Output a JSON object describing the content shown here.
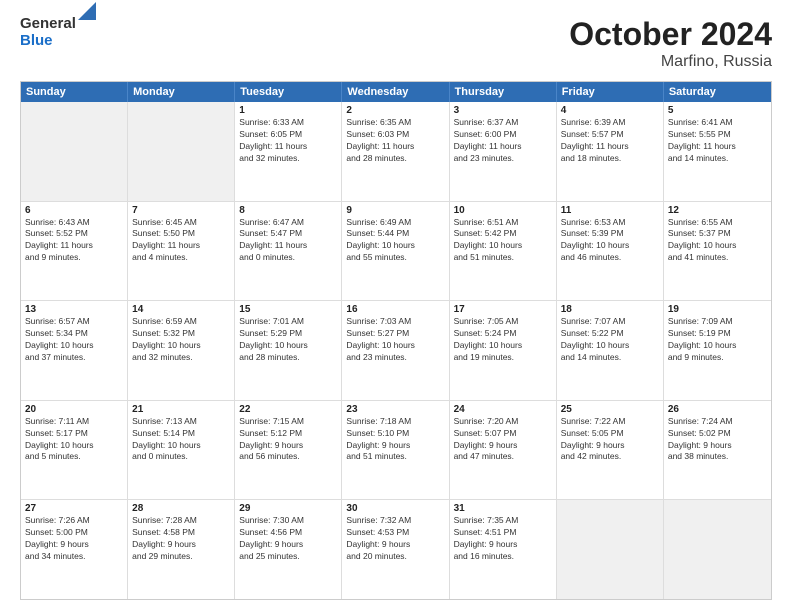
{
  "logo": {
    "general": "General",
    "blue": "Blue"
  },
  "title": "October 2024",
  "subtitle": "Marfino, Russia",
  "header_days": [
    "Sunday",
    "Monday",
    "Tuesday",
    "Wednesday",
    "Thursday",
    "Friday",
    "Saturday"
  ],
  "weeks": [
    [
      {
        "day": "",
        "info": ""
      },
      {
        "day": "",
        "info": ""
      },
      {
        "day": "1",
        "info": "Sunrise: 6:33 AM\nSunset: 6:05 PM\nDaylight: 11 hours\nand 32 minutes."
      },
      {
        "day": "2",
        "info": "Sunrise: 6:35 AM\nSunset: 6:03 PM\nDaylight: 11 hours\nand 28 minutes."
      },
      {
        "day": "3",
        "info": "Sunrise: 6:37 AM\nSunset: 6:00 PM\nDaylight: 11 hours\nand 23 minutes."
      },
      {
        "day": "4",
        "info": "Sunrise: 6:39 AM\nSunset: 5:57 PM\nDaylight: 11 hours\nand 18 minutes."
      },
      {
        "day": "5",
        "info": "Sunrise: 6:41 AM\nSunset: 5:55 PM\nDaylight: 11 hours\nand 14 minutes."
      }
    ],
    [
      {
        "day": "6",
        "info": "Sunrise: 6:43 AM\nSunset: 5:52 PM\nDaylight: 11 hours\nand 9 minutes."
      },
      {
        "day": "7",
        "info": "Sunrise: 6:45 AM\nSunset: 5:50 PM\nDaylight: 11 hours\nand 4 minutes."
      },
      {
        "day": "8",
        "info": "Sunrise: 6:47 AM\nSunset: 5:47 PM\nDaylight: 11 hours\nand 0 minutes."
      },
      {
        "day": "9",
        "info": "Sunrise: 6:49 AM\nSunset: 5:44 PM\nDaylight: 10 hours\nand 55 minutes."
      },
      {
        "day": "10",
        "info": "Sunrise: 6:51 AM\nSunset: 5:42 PM\nDaylight: 10 hours\nand 51 minutes."
      },
      {
        "day": "11",
        "info": "Sunrise: 6:53 AM\nSunset: 5:39 PM\nDaylight: 10 hours\nand 46 minutes."
      },
      {
        "day": "12",
        "info": "Sunrise: 6:55 AM\nSunset: 5:37 PM\nDaylight: 10 hours\nand 41 minutes."
      }
    ],
    [
      {
        "day": "13",
        "info": "Sunrise: 6:57 AM\nSunset: 5:34 PM\nDaylight: 10 hours\nand 37 minutes."
      },
      {
        "day": "14",
        "info": "Sunrise: 6:59 AM\nSunset: 5:32 PM\nDaylight: 10 hours\nand 32 minutes."
      },
      {
        "day": "15",
        "info": "Sunrise: 7:01 AM\nSunset: 5:29 PM\nDaylight: 10 hours\nand 28 minutes."
      },
      {
        "day": "16",
        "info": "Sunrise: 7:03 AM\nSunset: 5:27 PM\nDaylight: 10 hours\nand 23 minutes."
      },
      {
        "day": "17",
        "info": "Sunrise: 7:05 AM\nSunset: 5:24 PM\nDaylight: 10 hours\nand 19 minutes."
      },
      {
        "day": "18",
        "info": "Sunrise: 7:07 AM\nSunset: 5:22 PM\nDaylight: 10 hours\nand 14 minutes."
      },
      {
        "day": "19",
        "info": "Sunrise: 7:09 AM\nSunset: 5:19 PM\nDaylight: 10 hours\nand 9 minutes."
      }
    ],
    [
      {
        "day": "20",
        "info": "Sunrise: 7:11 AM\nSunset: 5:17 PM\nDaylight: 10 hours\nand 5 minutes."
      },
      {
        "day": "21",
        "info": "Sunrise: 7:13 AM\nSunset: 5:14 PM\nDaylight: 10 hours\nand 0 minutes."
      },
      {
        "day": "22",
        "info": "Sunrise: 7:15 AM\nSunset: 5:12 PM\nDaylight: 9 hours\nand 56 minutes."
      },
      {
        "day": "23",
        "info": "Sunrise: 7:18 AM\nSunset: 5:10 PM\nDaylight: 9 hours\nand 51 minutes."
      },
      {
        "day": "24",
        "info": "Sunrise: 7:20 AM\nSunset: 5:07 PM\nDaylight: 9 hours\nand 47 minutes."
      },
      {
        "day": "25",
        "info": "Sunrise: 7:22 AM\nSunset: 5:05 PM\nDaylight: 9 hours\nand 42 minutes."
      },
      {
        "day": "26",
        "info": "Sunrise: 7:24 AM\nSunset: 5:02 PM\nDaylight: 9 hours\nand 38 minutes."
      }
    ],
    [
      {
        "day": "27",
        "info": "Sunrise: 7:26 AM\nSunset: 5:00 PM\nDaylight: 9 hours\nand 34 minutes."
      },
      {
        "day": "28",
        "info": "Sunrise: 7:28 AM\nSunset: 4:58 PM\nDaylight: 9 hours\nand 29 minutes."
      },
      {
        "day": "29",
        "info": "Sunrise: 7:30 AM\nSunset: 4:56 PM\nDaylight: 9 hours\nand 25 minutes."
      },
      {
        "day": "30",
        "info": "Sunrise: 7:32 AM\nSunset: 4:53 PM\nDaylight: 9 hours\nand 20 minutes."
      },
      {
        "day": "31",
        "info": "Sunrise: 7:35 AM\nSunset: 4:51 PM\nDaylight: 9 hours\nand 16 minutes."
      },
      {
        "day": "",
        "info": ""
      },
      {
        "day": "",
        "info": ""
      }
    ]
  ]
}
